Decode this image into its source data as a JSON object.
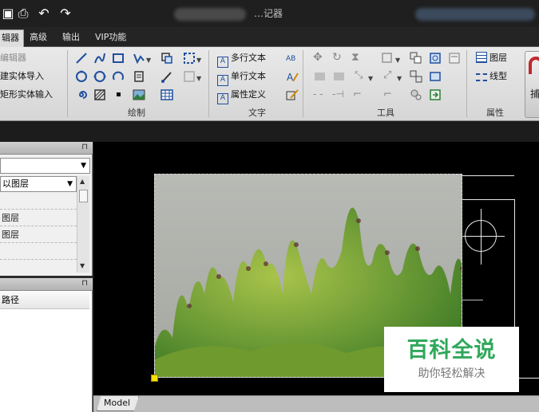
{
  "title": {
    "text": "…记器"
  },
  "quick_access": {
    "print_icon": "printer-icon",
    "undo_icon": "undo-icon",
    "redo_icon": "redo-icon"
  },
  "tabs": [
    {
      "label": "辑器",
      "active": true
    },
    {
      "label": "高级",
      "active": false
    },
    {
      "label": "输出",
      "active": false
    },
    {
      "label": "VIP功能",
      "active": false
    }
  ],
  "ribbon": {
    "left_group": {
      "items": [
        "编辑器",
        "建实体导入",
        "矩形实体输入"
      ]
    },
    "draw_group": {
      "label": "绘制"
    },
    "text_group": {
      "label": "文字",
      "items": [
        "多行文本",
        "单行文本",
        "属性定义"
      ]
    },
    "tools_group": {
      "label": "工具"
    },
    "props_group": {
      "label": "属性",
      "items": [
        "图层",
        "线型"
      ]
    },
    "capture_button": {
      "label": "捕"
    }
  },
  "left_panel": {
    "combo_empty": "",
    "layer_combo_value": "以图层",
    "list_items": [
      "",
      "图层",
      "图层",
      ""
    ],
    "path_header": "路径"
  },
  "layout_tabs": [
    {
      "label": "Model"
    }
  ],
  "watermark": {
    "main": "百科全说",
    "sub": "助你轻松解决"
  },
  "colors": {
    "grip": "#f5e100",
    "accent_blue": "#1f4f9e",
    "watermark_green": "#2fa85a"
  }
}
